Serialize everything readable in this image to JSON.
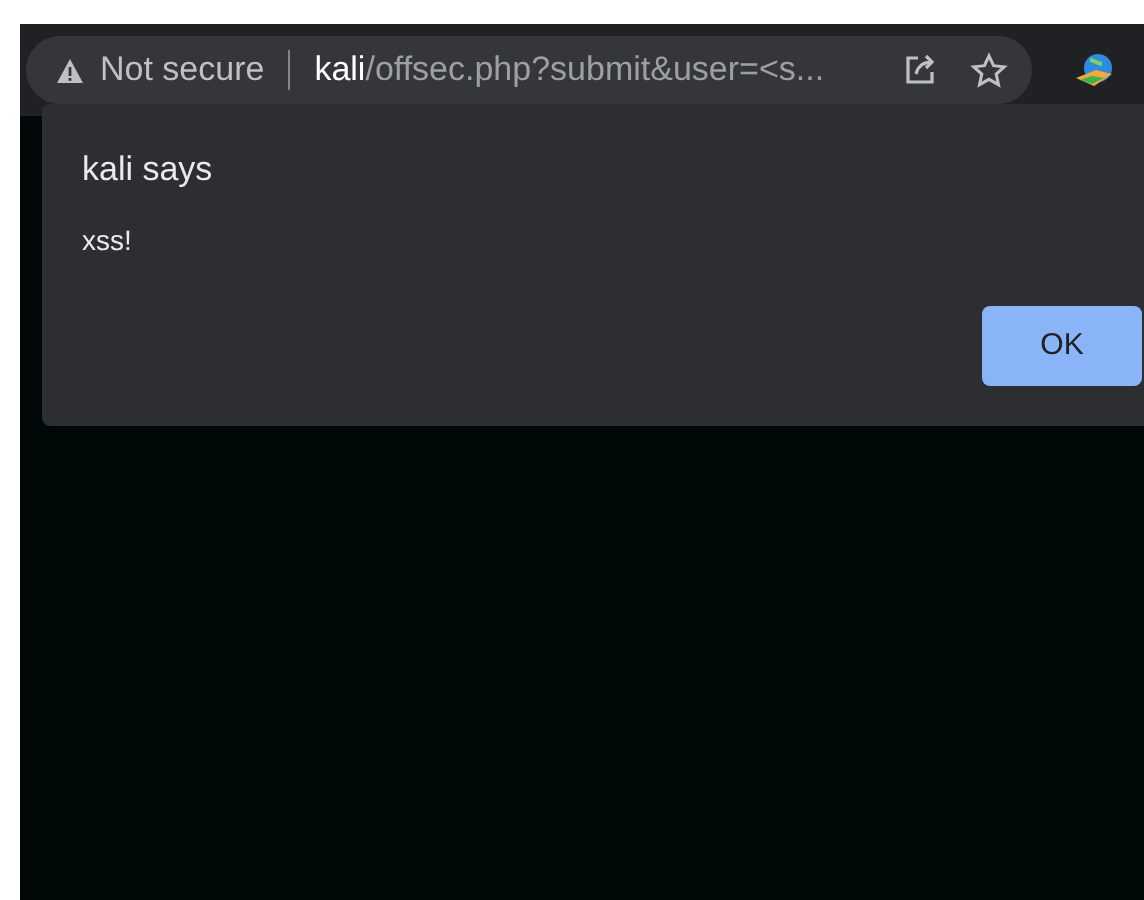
{
  "address_bar": {
    "security_label": "Not secure",
    "url_host": "kali",
    "url_path": "/offsec.php?submit&user=<s..."
  },
  "dialog": {
    "title": "kali says",
    "message": "xss!",
    "buttons": [
      "OK"
    ]
  }
}
